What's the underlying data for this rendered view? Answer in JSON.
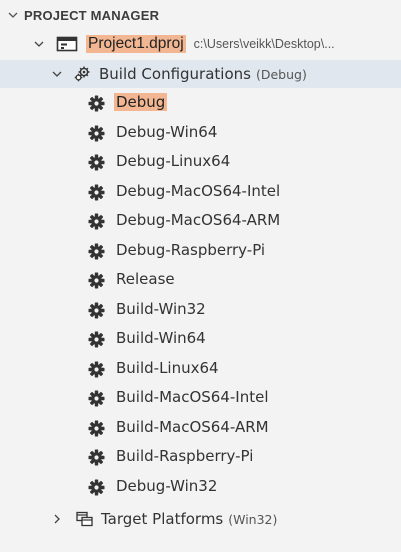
{
  "section": {
    "title": "PROJECT MANAGER"
  },
  "project": {
    "name": "Project1.dproj",
    "path": "c:\\Users\\veikk\\Desktop\\..."
  },
  "build_configs": {
    "label": "Build Configurations",
    "active": "(Debug)",
    "items": [
      "Debug",
      "Debug-Win64",
      "Debug-Linux64",
      "Debug-MacOS64-Intel",
      "Debug-MacOS64-ARM",
      "Debug-Raspberry-Pi",
      "Release",
      "Build-Win32",
      "Build-Win64",
      "Build-Linux64",
      "Build-MacOS64-Intel",
      "Build-MacOS64-ARM",
      "Build-Raspberry-Pi",
      "Debug-Win32"
    ],
    "highlighted_item": "Debug"
  },
  "target_platforms": {
    "label": "Target Platforms",
    "active": "(Win32)"
  },
  "colors": {
    "background": "#f3f3f3",
    "selected_row": "#e0e7ef",
    "highlight": "#f2b792",
    "text": "#333333"
  },
  "icons": {
    "section_toggle": "chevron-down-icon",
    "project": "project-icon",
    "build_configs": "build-configurations-icon",
    "config_item": "gear-icon",
    "target_platforms": "target-platforms-icon",
    "collapsed_toggle": "chevron-right-icon"
  }
}
